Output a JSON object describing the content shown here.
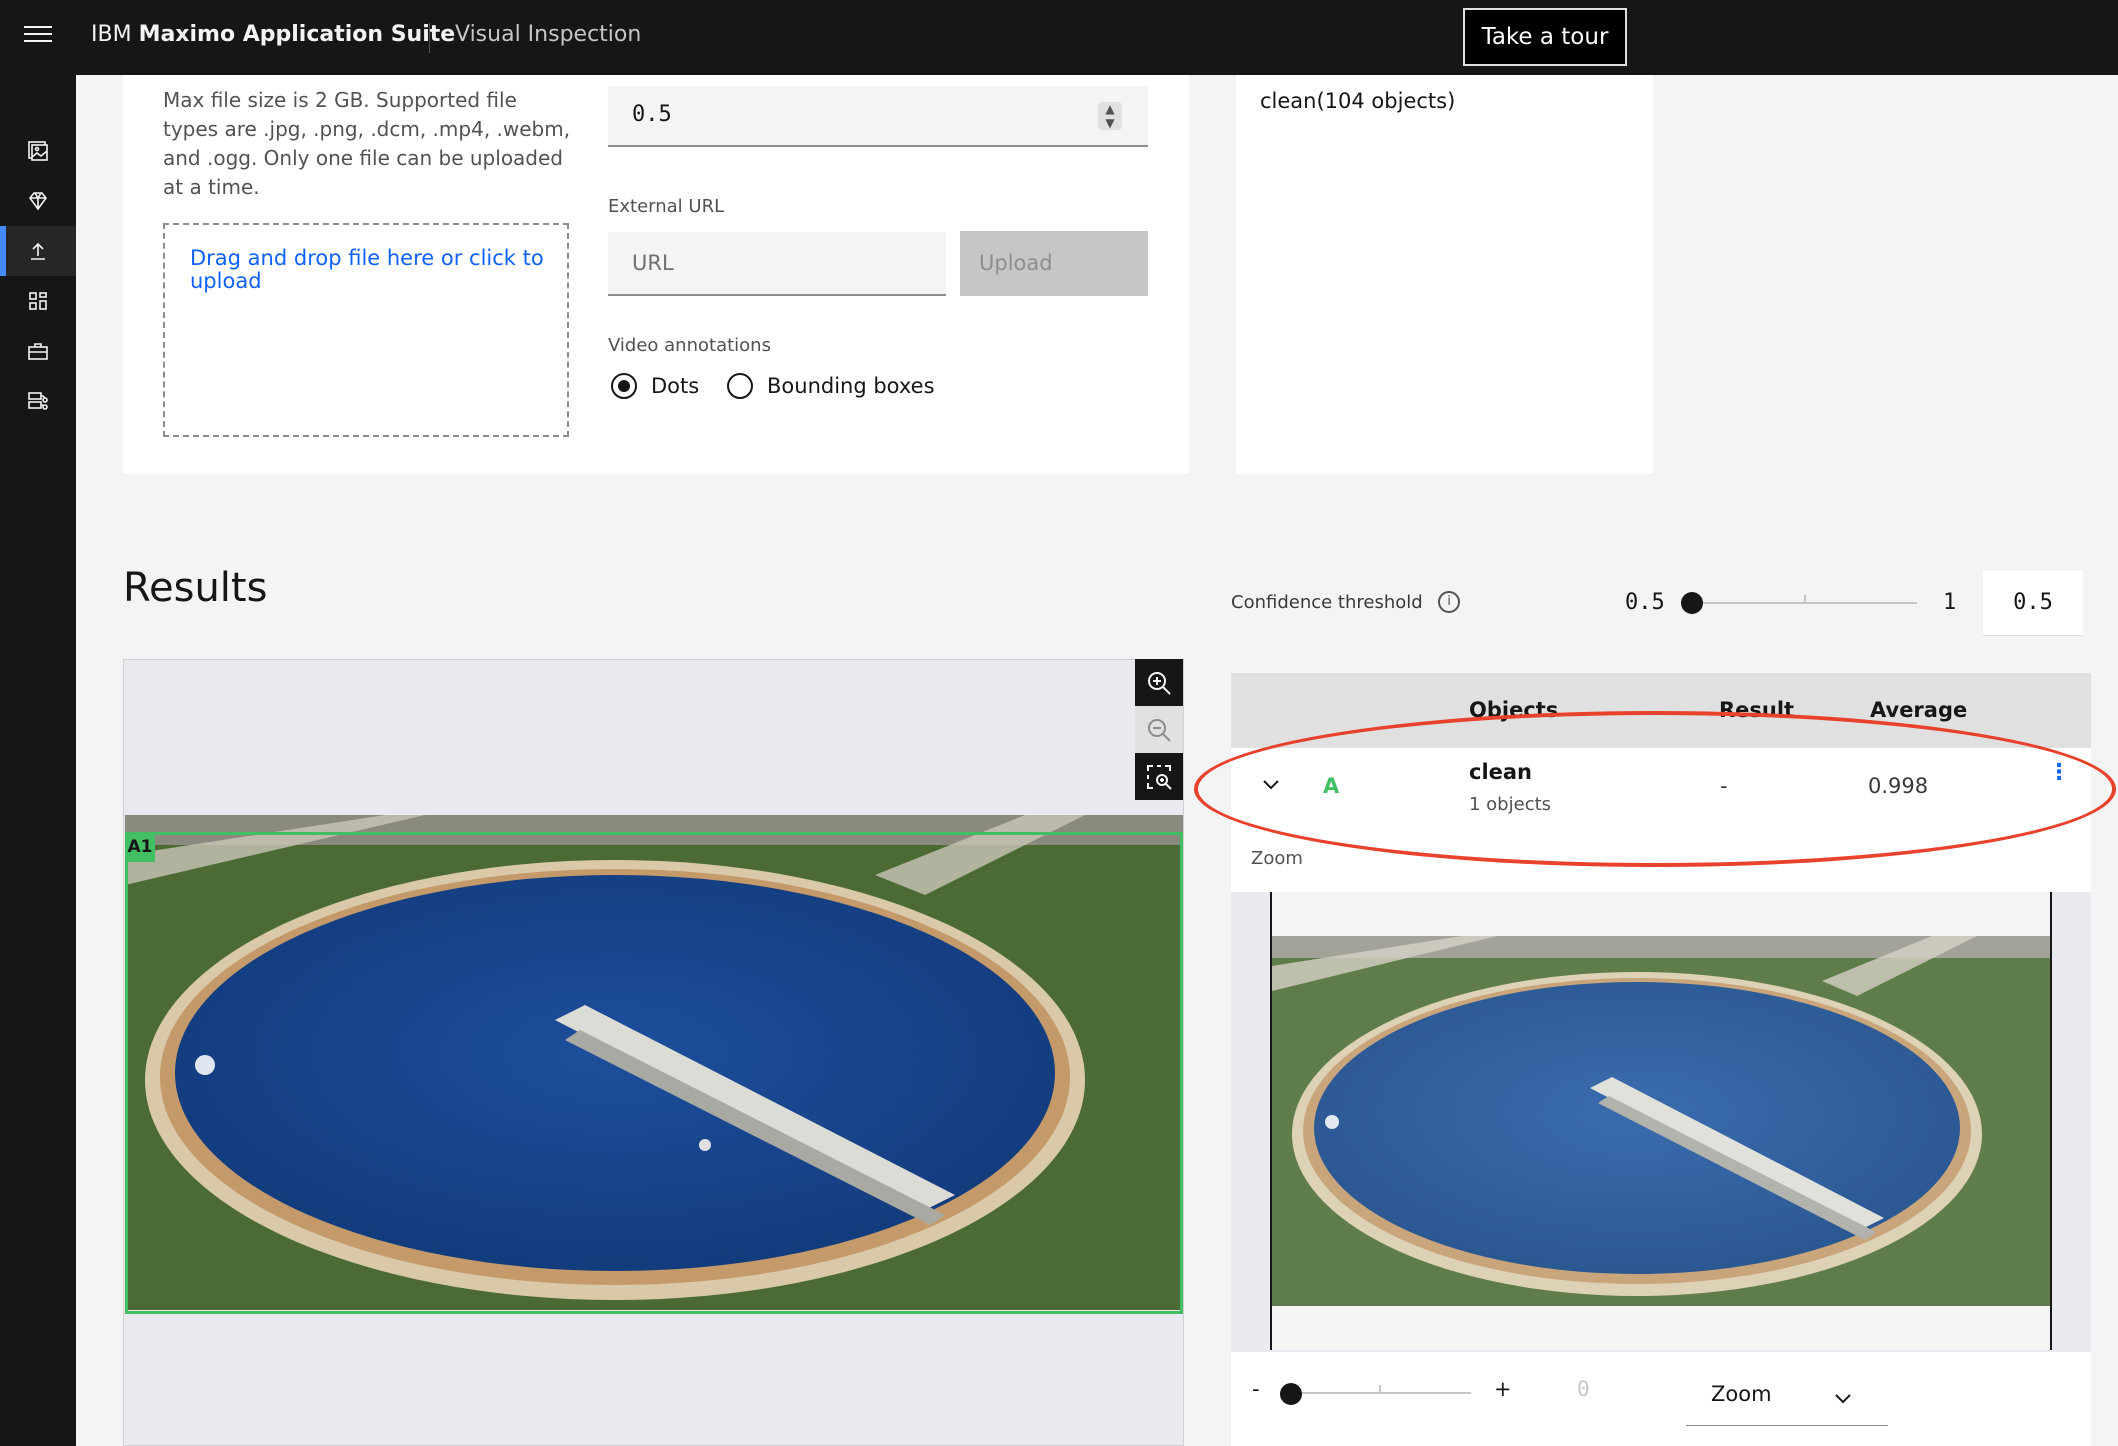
{
  "header": {
    "brand_prefix": "IBM",
    "brand_name": "Maximo Application Suite",
    "product": "Visual Inspection",
    "tour_label": "Take a tour"
  },
  "sidebar": {
    "items": [
      {
        "icon": "image-dataset-icon"
      },
      {
        "icon": "model-diamond-icon"
      },
      {
        "icon": "upload-icon",
        "active": true
      },
      {
        "icon": "dashboard-grid-icon"
      },
      {
        "icon": "toolbox-icon"
      },
      {
        "icon": "data-flow-icon"
      }
    ]
  },
  "upload": {
    "note": "Max file size is 2 GB. Supported file types are .jpg, .png, .dcm, .mp4, .webm, and .ogg. Only one file can be uploaded at a time.",
    "drop_text": "Drag and drop file here or click to upload",
    "threshold_value": "0.5",
    "external_url_label": "External URL",
    "url_placeholder": "URL",
    "upload_label": "Upload",
    "video_annotations_label": "Video annotations",
    "radio_dots": "Dots",
    "radio_boxes": "Bounding boxes",
    "selected": "Dots"
  },
  "summary": {
    "text": "clean(104 objects)"
  },
  "results": {
    "title": "Results",
    "confidence_label": "Confidence threshold",
    "slider_min": "0.5",
    "slider_max": "1",
    "slider_value": "0.5",
    "box_label": "A1"
  },
  "table": {
    "headers": [
      "Objects",
      "Result",
      "Average"
    ],
    "rows": [
      {
        "letter": "A",
        "name": "clean",
        "count": "1 objects",
        "result": "-",
        "average": "0.998"
      }
    ],
    "zoom_label": "Zoom"
  },
  "zoom_control": {
    "minus": "-",
    "plus": "+",
    "value": "0",
    "select_label": "Zoom"
  },
  "colors": {
    "accent": "#0f62fe",
    "box_green": "#42be65",
    "annotation_red": "#e8412c",
    "header_bg": "#161616"
  }
}
